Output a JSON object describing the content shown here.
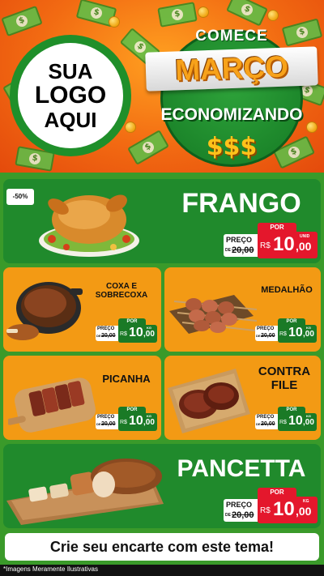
{
  "header": {
    "logo_lines": [
      "SUA",
      "LOGO",
      "AQUI"
    ],
    "promo_top": "COMECE",
    "promo_month": "MARÇO",
    "promo_bottom": "ECONOMIZANDO",
    "promo_dollars": "$$$"
  },
  "discount_badge": "-50%",
  "price_labels": {
    "por": "POR",
    "preco": "PREÇO",
    "de": "DE"
  },
  "products": [
    {
      "name": "FRANGO",
      "old_price": "20,00",
      "currency": "R$",
      "price_int": "10",
      "price_dec": ",00",
      "unit": "UNID"
    },
    {
      "name": "COXA E SOBRECOXA",
      "old_price": "20,00",
      "currency": "R$",
      "price_int": "10",
      "price_dec": ",00",
      "unit": "KG"
    },
    {
      "name": "MEDALHÃO",
      "old_price": "20,00",
      "currency": "R$",
      "price_int": "10",
      "price_dec": ",00",
      "unit": "KG"
    },
    {
      "name": "PICANHA",
      "old_price": "20,00",
      "currency": "R$",
      "price_int": "10",
      "price_dec": ",00",
      "unit": "KG"
    },
    {
      "name": "CONTRA FILE",
      "old_price": "20,00",
      "currency": "R$",
      "price_int": "10",
      "price_dec": ",00",
      "unit": "KG"
    },
    {
      "name": "PANCETTA",
      "old_price": "20,00",
      "currency": "R$",
      "price_int": "10",
      "price_dec": ",00",
      "unit": "KG"
    }
  ],
  "footer_banner": "Crie seu encarte com este tema!",
  "footnote": "*Imagens Meramente Ilustrativas",
  "colors": {
    "green": "#208a2c",
    "orange": "#f39a14",
    "price_red": "#e4172c",
    "header_orange": "#f26a12"
  }
}
